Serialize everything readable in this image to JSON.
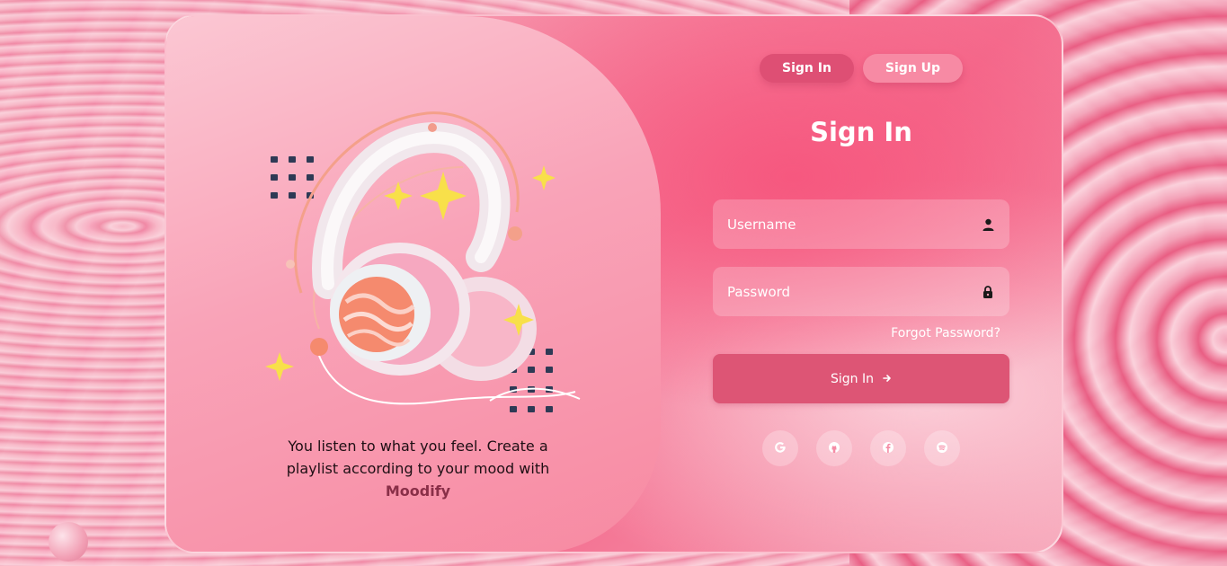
{
  "app": {
    "brand": "Moodify",
    "tagline": "You listen to what you feel. Create a playlist according to your mood with"
  },
  "tabs": [
    {
      "label": "Sign In",
      "active": true
    },
    {
      "label": "Sign Up",
      "active": false
    }
  ],
  "form": {
    "title": "Sign In",
    "username": {
      "placeholder": "Username",
      "value": "",
      "icon": "user-icon"
    },
    "password": {
      "placeholder": "Password",
      "value": "",
      "icon": "lock-icon"
    },
    "forgot_label": "Forgot Password?",
    "submit_label": "Sign In",
    "submit_icon": "arrow-right-icon"
  },
  "social": [
    {
      "name": "google",
      "icon": "google-icon"
    },
    {
      "name": "github",
      "icon": "github-icon"
    },
    {
      "name": "facebook",
      "icon": "facebook-icon"
    },
    {
      "name": "spotify",
      "icon": "spotify-icon"
    }
  ],
  "colors": {
    "accent": "#de4f74",
    "secondary_tab": "#f78aa4",
    "brand_text": "#8a2f48",
    "text_light": "#ffffff"
  }
}
